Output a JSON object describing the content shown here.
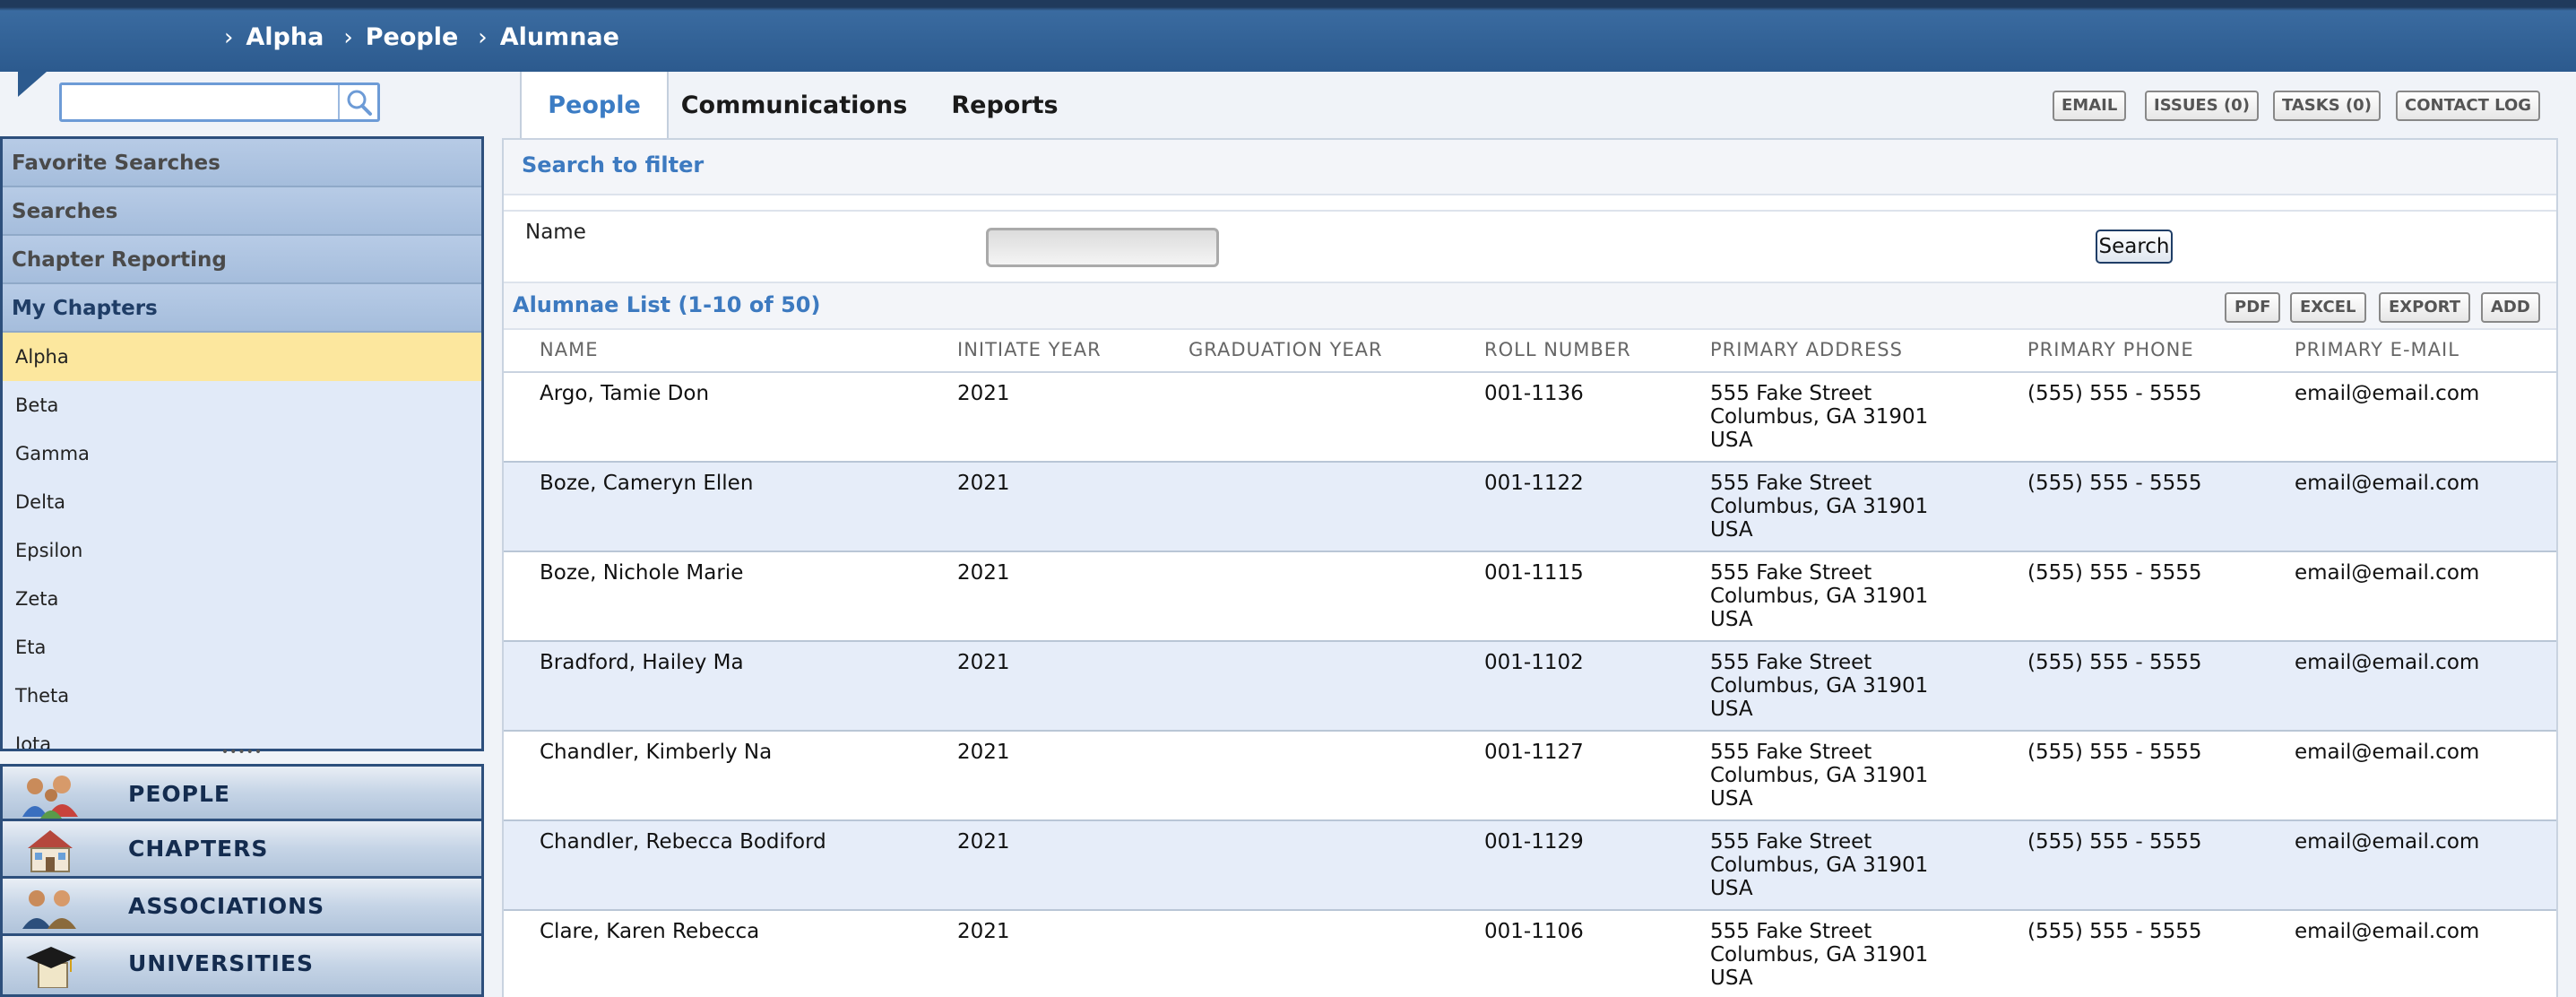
{
  "breadcrumb": [
    "Alpha",
    "People",
    "Alumnae"
  ],
  "sidebar": {
    "search_placeholder": "",
    "sections": [
      "Favorite Searches",
      "Searches",
      "Chapter Reporting",
      "My Chapters"
    ],
    "chapters": [
      "Alpha",
      "Beta",
      "Gamma",
      "Delta",
      "Epsilon",
      "Zeta",
      "Eta",
      "Theta",
      "Iota"
    ],
    "selected_chapter": "Alpha",
    "grip": "•••••",
    "nav": [
      "PEOPLE",
      "CHAPTERS",
      "ASSOCIATIONS",
      "UNIVERSITIES"
    ]
  },
  "tabs": [
    "People",
    "Communications",
    "Reports"
  ],
  "active_tab": "People",
  "top_buttons": [
    "EMAIL",
    "ISSUES (0)",
    "TASKS (0)",
    "CONTACT LOG"
  ],
  "filter": {
    "title": "Search to filter",
    "name_label": "Name",
    "name_value": "",
    "search_label": "Search"
  },
  "list": {
    "title": "Alumnae List (1-10 of 50)",
    "buttons": [
      "PDF",
      "EXCEL",
      "EXPORT",
      "ADD"
    ],
    "columns": [
      "NAME",
      "INITIATE YEAR",
      "GRADUATION YEAR",
      "ROLL NUMBER",
      "PRIMARY ADDRESS",
      "PRIMARY PHONE",
      "PRIMARY E-MAIL"
    ],
    "rows": [
      {
        "name": "Argo, Tamie Don",
        "initiate": "2021",
        "graduation": "",
        "roll": "001-1136",
        "addr1": "555 Fake Street",
        "addr2": "Columbus, GA 31901",
        "addr3": "USA",
        "phone": "(555) 555 - 5555",
        "email": "email@email.com"
      },
      {
        "name": "Boze, Cameryn Ellen",
        "initiate": "2021",
        "graduation": "",
        "roll": "001-1122",
        "addr1": "555 Fake Street",
        "addr2": "Columbus, GA 31901",
        "addr3": "USA",
        "phone": "(555) 555 - 5555",
        "email": "email@email.com"
      },
      {
        "name": "Boze, Nichole Marie",
        "initiate": "2021",
        "graduation": "",
        "roll": "001-1115",
        "addr1": "555 Fake Street",
        "addr2": "Columbus, GA 31901",
        "addr3": "USA",
        "phone": "(555) 555 - 5555",
        "email": "email@email.com"
      },
      {
        "name": "Bradford, Hailey Ma",
        "initiate": "2021",
        "graduation": "",
        "roll": "001-1102",
        "addr1": "555 Fake Street",
        "addr2": "Columbus, GA 31901",
        "addr3": "USA",
        "phone": "(555) 555 - 5555",
        "email": "email@email.com"
      },
      {
        "name": "Chandler, Kimberly Na",
        "initiate": "2021",
        "graduation": "",
        "roll": "001-1127",
        "addr1": "555 Fake Street",
        "addr2": "Columbus, GA 31901",
        "addr3": "USA",
        "phone": "(555) 555 - 5555",
        "email": "email@email.com"
      },
      {
        "name": "Chandler, Rebecca Bodiford",
        "initiate": "2021",
        "graduation": "",
        "roll": "001-1129",
        "addr1": "555 Fake Street",
        "addr2": "Columbus, GA 31901",
        "addr3": "USA",
        "phone": "(555) 555 - 5555",
        "email": "email@email.com"
      },
      {
        "name": "Clare, Karen Rebecca",
        "initiate": "2021",
        "graduation": "",
        "roll": "001-1106",
        "addr1": "555 Fake Street",
        "addr2": "Columbus, GA 31901",
        "addr3": "USA",
        "phone": "(555) 555 - 5555",
        "email": "email@email.com"
      }
    ]
  },
  "colors": {
    "header": "#2c5a8e",
    "accent": "#3d7ac0",
    "selected": "#fce79e",
    "alt_row": "#e6edf9"
  }
}
